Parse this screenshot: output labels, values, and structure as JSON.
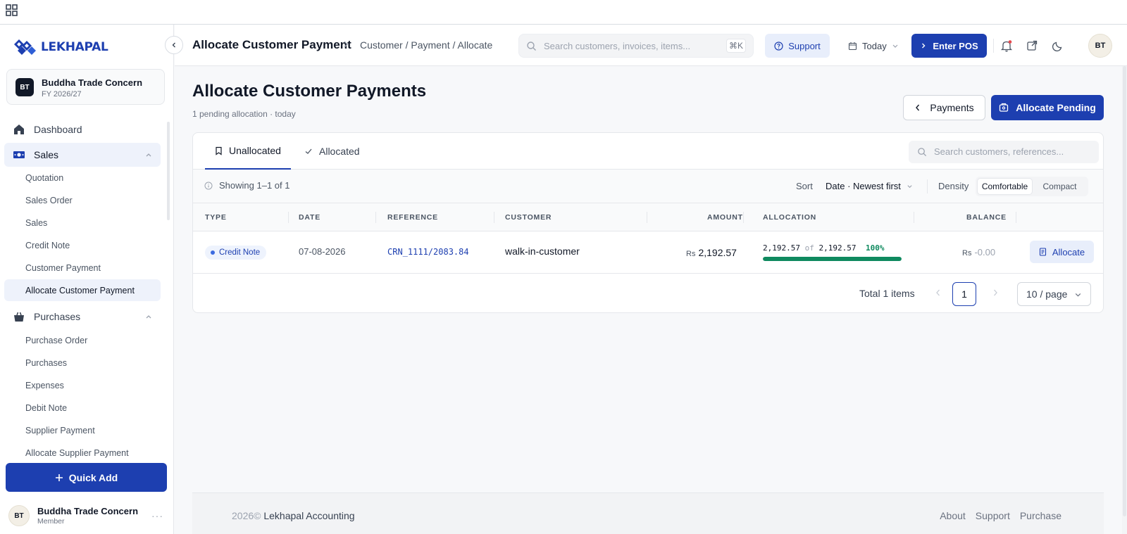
{
  "app": {
    "logo_text": "LEKHAPAL",
    "brand_color": "#1d3fb0"
  },
  "org": {
    "initials": "BT",
    "name": "Buddha Trade Concern",
    "fy": "FY 2026/27"
  },
  "sidebar": {
    "dashboard": "Dashboard",
    "sales": "Sales",
    "sales_items": [
      "Quotation",
      "Sales Order",
      "Sales",
      "Credit Note",
      "Customer Payment",
      "Allocate Customer Payment"
    ],
    "purchases": "Purchases",
    "purchase_items": [
      "Purchase Order",
      "Purchases",
      "Expenses",
      "Debit Note",
      "Supplier Payment",
      "Allocate Supplier Payment"
    ],
    "quick_add": "Quick Add",
    "user": {
      "initials": "BT",
      "name": "Buddha Trade Concern",
      "role": "Member"
    }
  },
  "header": {
    "title": "Allocate Customer Payment",
    "breadcrumb": "Customer / Payment / Allocate",
    "search_placeholder": "Search customers, invoices, items...",
    "shortcut": "⌘K",
    "support": "Support",
    "date_filter": "Today",
    "enter_pos": "Enter POS",
    "avatar": "BT"
  },
  "page": {
    "title": "Allocate Customer Payments",
    "subtitle": "1 pending allocation · today",
    "back_button": "Payments",
    "primary_button": "Allocate Pending"
  },
  "tabs": [
    {
      "label": "Unallocated",
      "active": true
    },
    {
      "label": "Allocated",
      "active": false
    }
  ],
  "table_search_placeholder": "Search customers, references...",
  "toolbar": {
    "showing": "Showing 1–1 of 1",
    "sort_label": "Sort",
    "sort_value": "Date · Newest first",
    "density_label": "Density",
    "density_options": [
      "Comfortable",
      "Compact"
    ],
    "density_selected": "Comfortable"
  },
  "columns": [
    "TYPE",
    "DATE",
    "REFERENCE",
    "CUSTOMER",
    "AMOUNT",
    "ALLOCATION",
    "BALANCE"
  ],
  "rows": [
    {
      "type": "Credit Note",
      "date": "07-08-2026",
      "reference": "CRN_1111/2083.84",
      "customer": "walk-in-customer",
      "currency": "Rs",
      "amount": "2,192.57",
      "allocated": "2,192.57",
      "of": "of",
      "total": "2,192.57",
      "percent": "100%",
      "progress": 1.0,
      "balance": "-0.00",
      "action": "Allocate"
    }
  ],
  "pagination": {
    "total": "Total 1 items",
    "page": "1",
    "page_size": "10 / page"
  },
  "footer": {
    "year": "2026©",
    "company": "Lekhapal Accounting",
    "links": [
      "About",
      "Support",
      "Purchase"
    ]
  },
  "colors": {
    "primary": "#1d3fb0",
    "success": "#0f8a5f",
    "badge_bg": "#eef3fd"
  }
}
